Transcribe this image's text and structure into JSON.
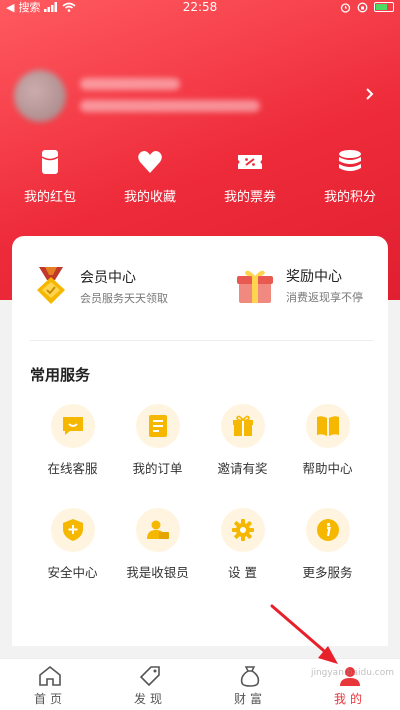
{
  "status_bar": {
    "carrier": "搜索",
    "time": "22:58"
  },
  "header": {
    "more_icon": "chevron-right-icon"
  },
  "quick_actions": [
    {
      "label": "我的红包",
      "icon": "red-envelope-icon"
    },
    {
      "label": "我的收藏",
      "icon": "heart-icon"
    },
    {
      "label": "我的票券",
      "icon": "ticket-icon"
    },
    {
      "label": "我的积分",
      "icon": "coins-stack-icon"
    }
  ],
  "benefits": [
    {
      "title": "会员中心",
      "subtitle": "会员服务天天领取",
      "icon": "member-medal-icon"
    },
    {
      "title": "奖励中心",
      "subtitle": "消费返现享不停",
      "icon": "gift-box-icon"
    }
  ],
  "services": {
    "title": "常用服务",
    "items": [
      {
        "label": "在线客服",
        "icon": "chat-icon"
      },
      {
        "label": "我的订单",
        "icon": "order-list-icon"
      },
      {
        "label": "邀请有奖",
        "icon": "gift-icon"
      },
      {
        "label": "帮助中心",
        "icon": "book-icon"
      },
      {
        "label": "安全中心",
        "icon": "shield-plus-icon"
      },
      {
        "label": "我是收银员",
        "icon": "cashier-icon"
      },
      {
        "label": "设 置",
        "icon": "gear-icon"
      },
      {
        "label": "更多服务",
        "icon": "info-icon"
      }
    ]
  },
  "tabbar": {
    "active": "我的",
    "tabs": [
      {
        "label": "首页",
        "icon": "home-icon"
      },
      {
        "label": "发现",
        "icon": "tag-icon"
      },
      {
        "label": "财富",
        "icon": "money-bag-icon"
      },
      {
        "label": "我的",
        "icon": "user-icon"
      }
    ]
  },
  "colors": {
    "brand_red": "#e8353a",
    "icon_gold": "#f5b700",
    "icon_circle_bg": "#fff4e0"
  },
  "watermark": "jingyan.baidu.com"
}
